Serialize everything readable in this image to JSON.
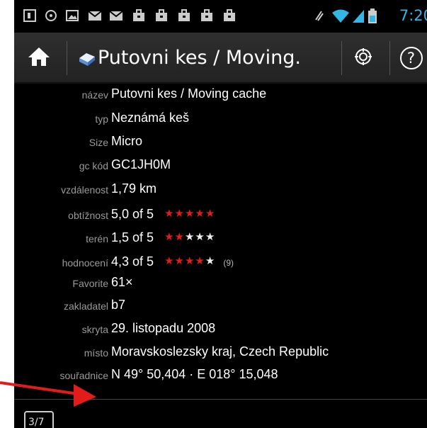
{
  "status_bar": {
    "time": "7:20",
    "colors": {
      "time": "#33b5e5"
    },
    "left_icons": [
      "notification-icon",
      "location-icon",
      "image-icon",
      "gmail-icon",
      "mail-icon",
      "briefcase-icon",
      "briefcase-icon",
      "briefcase-icon",
      "briefcase-icon",
      "briefcase-icon"
    ],
    "right_icons": [
      "vibrate-icon",
      "wifi-icon",
      "signal-icon",
      "battery-icon"
    ]
  },
  "action_bar": {
    "title": "Putovni kes / Moving.",
    "home_icon": "home-icon",
    "cache_type_icon": "cache-type-icon",
    "buttons": [
      "compass-icon",
      "help-icon"
    ],
    "help_glyph": "?"
  },
  "details": [
    {
      "label": "název",
      "value": "Putovni kes / Moving cache"
    },
    {
      "label": "typ",
      "value": "Neznámá keš"
    },
    {
      "label": "Size",
      "value": "Micro"
    },
    {
      "label": "gc kód",
      "value": "GC1JH0M"
    },
    {
      "label": "vzdálenost",
      "value": "1,79 km"
    },
    {
      "label": "obtížnost",
      "value": "5,0 of 5",
      "rating": 5.0,
      "stars": "★★★★★",
      "stars_off": ""
    },
    {
      "label": "terén",
      "value": "1,5 of 5",
      "rating": 1.5,
      "stars": "★★",
      "stars_off": "★★★"
    },
    {
      "label": "hodnocení",
      "value": "4,3 of 5",
      "rating": 4.3,
      "stars": "★★★★",
      "stars_off": "★",
      "votes": "(9)"
    },
    {
      "label": "Favorite",
      "value": "61×"
    },
    {
      "label": "zakladatel",
      "value": "b7"
    },
    {
      "label": "skryta",
      "value": "29. listopadu 2008"
    },
    {
      "label": "místo",
      "value": "Moravskoslezsky kraj, Czech Republic"
    },
    {
      "label": "souřadnice",
      "value": "N 49° 50,404 · E 018° 15,048"
    }
  ],
  "bottom": {
    "page_button": "3/7"
  },
  "annotation": {
    "arrow_color": "#e21b1b"
  },
  "colors": {
    "accent_star": "#e21b1b",
    "label": "#9a9a9a",
    "value": "#ffffff",
    "background": "#000000"
  }
}
